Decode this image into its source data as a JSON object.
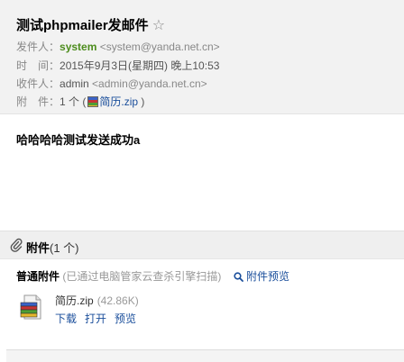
{
  "mail": {
    "subject": "测试phpmailer发邮件",
    "star": "☆",
    "from": {
      "label": "发件人：",
      "name": "system",
      "addr": "<system@yanda.net.cn>"
    },
    "time": {
      "label": "时　间：",
      "value": "2015年9月3日(星期四) 晚上10:53"
    },
    "to": {
      "label": "收件人：",
      "name": "admin",
      "addr": "<admin@yanda.net.cn>"
    },
    "attach_meta": {
      "label": "附　件：",
      "count": "1 个 (",
      "file": "简历.zip",
      "close": " )"
    },
    "body": "哈哈哈哈测试发送成功a"
  },
  "attachments": {
    "title": "附件",
    "count": "(1 个)",
    "section_title": "普通附件",
    "section_note": "(已通过电脑管家云查杀引擎扫描)",
    "preview_all": "附件预览",
    "file": {
      "name": "简历.zip",
      "size": "(42.86K)",
      "actions": [
        "下载",
        "打开",
        "预览"
      ]
    }
  }
}
